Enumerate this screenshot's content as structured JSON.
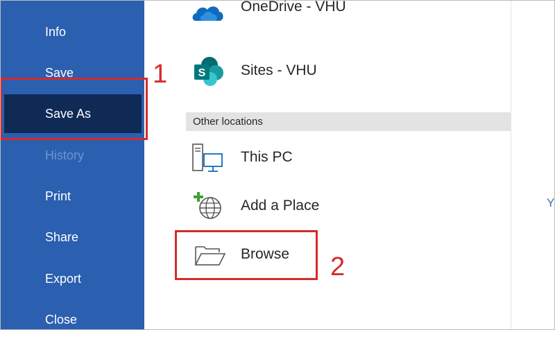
{
  "sidebar": {
    "items": [
      {
        "label": "Info"
      },
      {
        "label": "Save"
      },
      {
        "label": "Save As"
      },
      {
        "label": "History"
      },
      {
        "label": "Print"
      },
      {
        "label": "Share"
      },
      {
        "label": "Export"
      },
      {
        "label": "Close"
      }
    ]
  },
  "locations": {
    "onedrive": {
      "label": "OneDrive - VHU"
    },
    "sites": {
      "label": "Sites - VHU"
    },
    "other_header": "Other locations",
    "this_pc": {
      "label": "This PC"
    },
    "add_place": {
      "label": "Add a Place"
    },
    "browse": {
      "label": "Browse"
    }
  },
  "right_pane": {
    "partial_text": "Y"
  },
  "annotations": {
    "step1": "1",
    "step2": "2"
  },
  "colors": {
    "sidebar_bg": "#2b5fb0",
    "selected_bg": "#0e2a55",
    "annotation_red": "#d62a2a",
    "sharepoint_teal": "#038387"
  },
  "icons": {
    "onedrive": "cloud-icon",
    "sites": "sharepoint-icon",
    "this_pc": "computer-icon",
    "add_place": "globe-add-icon",
    "browse": "folder-open-icon"
  }
}
